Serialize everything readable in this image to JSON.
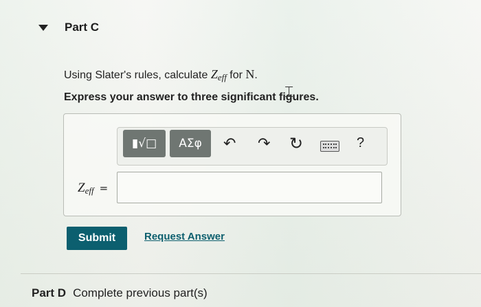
{
  "part_c": {
    "title": "Part C",
    "question_prefix": "Using Slater's rules, calculate ",
    "z_symbol": "Z",
    "z_subscript": "eff",
    "question_mid": " for ",
    "element": "N",
    "question_end": ".",
    "instruction": "Express your answer to three significant figures."
  },
  "toolbar": {
    "template_label": "▮√□",
    "symbols_label": "ΑΣφ",
    "undo_icon": "↶",
    "redo_icon": "↷",
    "reset_icon": "↻",
    "keyboard_icon": "keyboard-icon",
    "help_label": "?"
  },
  "answer": {
    "z_symbol": "Z",
    "z_subscript": "eff",
    "equals": "=",
    "value": ""
  },
  "actions": {
    "submit_label": "Submit",
    "request_label": "Request Answer"
  },
  "part_d": {
    "label": "Part D",
    "status": "Complete previous part(s)"
  },
  "colors": {
    "submit_bg": "#0c5f6f",
    "link": "#0d5f6e",
    "toolbar_button": "#6f7672"
  }
}
